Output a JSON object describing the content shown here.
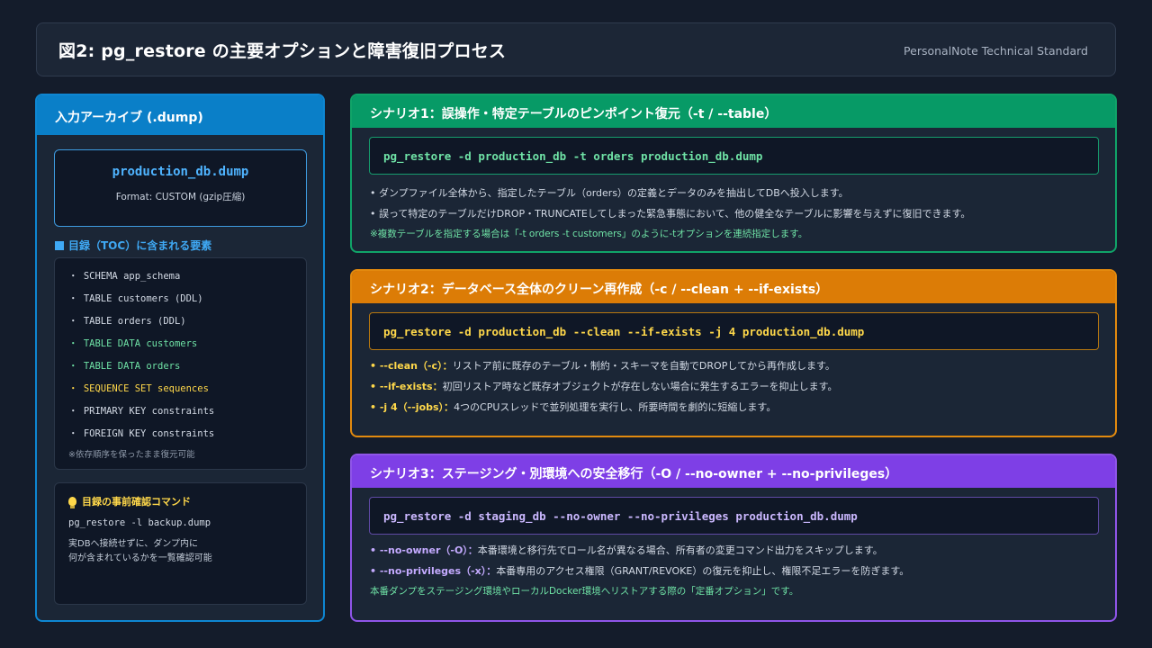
{
  "header": {
    "title": "図2: pg_restore の主要オプションと障害復旧プロセス",
    "brand": "PersonalNote Technical Standard"
  },
  "archive": {
    "heading": "入力アーカイブ (.dump)",
    "filename": "production_db.dump",
    "format": "Format: CUSTOM (gzip圧縮)",
    "toc_title": "目録（TOC）に含まれる要素",
    "toc_items": [
      "・ SCHEMA app_schema",
      "・ TABLE customers (DDL)",
      "・ TABLE orders (DDL)",
      "・ TABLE DATA customers",
      "・ TABLE DATA orders",
      "・ SEQUENCE SET sequences",
      "・ PRIMARY KEY constraints",
      "・ FOREIGN KEY constraints"
    ],
    "toc_note": "※依存順序を保ったまま復元可能",
    "check_title": "目録の事前確認コマンド",
    "check_command": "pg_restore -l backup.dump",
    "check_desc_1": "実DBへ接続せずに、ダンプ内に",
    "check_desc_2": "何が含まれているかを一覧確認可能"
  },
  "scenarios": [
    {
      "title": "シナリオ1：誤操作・特定テーブルのピンポイント復元（-t / --table）",
      "command": "pg_restore -d production_db -t orders production_db.dump",
      "line1": "• ダンプファイル全体から、指定したテーブル（orders）の定義とデータのみを抽出してDBへ投入します。",
      "line2": "• 誤って特定のテーブルだけDROP・TRUNCATEしてしまった緊急事態において、他の健全なテーブルに影響を与えずに復旧できます。",
      "note": "※複数テーブルを指定する場合は「-t orders -t customers」のように-tオプションを連続指定します。"
    },
    {
      "title": "シナリオ2：データベース全体のクリーン再作成（-c / --clean + --if-exists）",
      "command": "pg_restore -d production_db --clean --if-exists -j 4 production_db.dump",
      "kw1": "• --clean（-c）：",
      "text1": "リストア前に既存のテーブル・制約・スキーマを自動でDROPしてから再作成します。",
      "kw2": "• --if-exists：",
      "text2": "初回リストア時など既存オブジェクトが存在しない場合に発生するエラーを抑止します。",
      "kw3": "• -j 4（--jobs）：",
      "text3": "4つのCPUスレッドで並列処理を実行し、所要時間を劇的に短縮します。"
    },
    {
      "title": "シナリオ3：ステージング・別環境への安全移行（-O / --no-owner + --no-privileges）",
      "command": "pg_restore -d staging_db --no-owner --no-privileges production_db.dump",
      "kw1": "• --no-owner（-O）：",
      "text1": "本番環境と移行先でロール名が異なる場合、所有者の変更コマンド出力をスキップします。",
      "kw2": "• --no-privileges（-x）：",
      "text2": "本番専用のアクセス権限（GRANT/REVOKE）の復元を抑止し、権限不足エラーを防ぎます。",
      "note": "本番ダンプをステージング環境やローカルDocker環境へリストアする際の「定番オプション」です。"
    }
  ]
}
